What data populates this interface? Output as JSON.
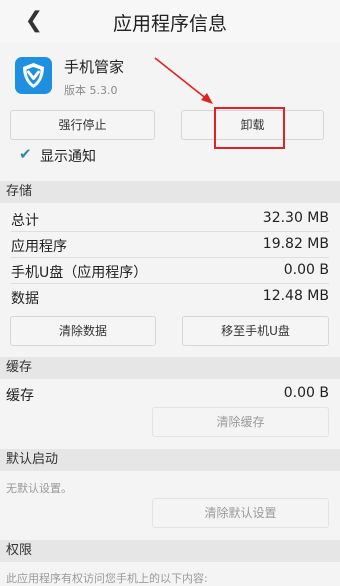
{
  "header": {
    "back_glyph": "❮",
    "title": "应用程序信息"
  },
  "app": {
    "name": "手机管家",
    "version": "版本 5.3.0",
    "icon": "shield-app-icon"
  },
  "buttons": {
    "force_stop": "强行停止",
    "uninstall": "卸载"
  },
  "notification": {
    "checked": true,
    "label": "显示通知"
  },
  "storage": {
    "title": "存储",
    "rows": [
      {
        "label": "总计",
        "value": "32.30 MB"
      },
      {
        "label": "应用程序",
        "value": "19.82 MB"
      },
      {
        "label": "手机U盘（应用程序）",
        "value": "0.00 B"
      },
      {
        "label": "数据",
        "value": "12.48 MB"
      }
    ],
    "clear_data": "清除数据",
    "move_to_usb": "移至手机U盘"
  },
  "cache": {
    "title": "缓存",
    "label": "缓存",
    "value": "0.00 B",
    "clear_cache": "清除缓存"
  },
  "default_launch": {
    "title": "默认启动",
    "note": "无默认设置。",
    "clear_defaults": "清除默认设置"
  },
  "permissions": {
    "title": "权限",
    "note": "此应用程序有权访问您手机上的以下内容:"
  },
  "annotation": {
    "color": "#e02222"
  }
}
